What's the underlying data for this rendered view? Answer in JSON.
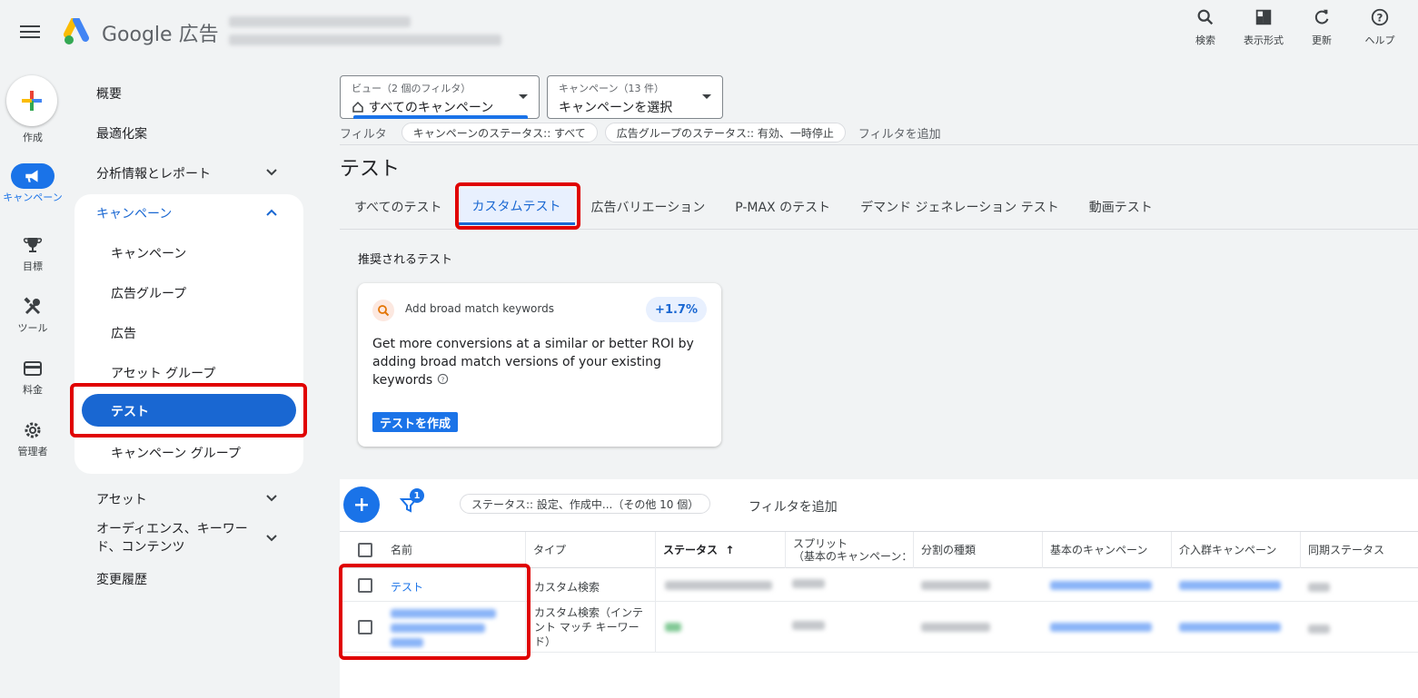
{
  "header": {
    "brand": "Google 広告",
    "actions": [
      {
        "label": "検索",
        "icon": "search-icon"
      },
      {
        "label": "表示形式",
        "icon": "appearance-icon"
      },
      {
        "label": "更新",
        "icon": "refresh-icon"
      },
      {
        "label": "ヘルプ",
        "icon": "help-icon"
      }
    ]
  },
  "rail": {
    "create": "作成",
    "campaign": "キャンペーン",
    "goals": "目標",
    "tools": "ツール",
    "billing": "料金",
    "admin": "管理者"
  },
  "sidebar": {
    "overview": "概要",
    "recommendations": "最適化案",
    "insights": "分析情報とレポート",
    "campaigns": "キャンペーン",
    "sub": [
      "キャンペーン",
      "広告グループ",
      "広告",
      "アセット グループ",
      "テスト",
      "キャンペーン グループ"
    ],
    "assets": "アセット",
    "audiences": "オーディエンス、キーワード、コンテンツ",
    "audiences_line1": "オーディエンス、キーワー",
    "audiences_line2": "ド、コンテンツ",
    "change_history": "変更履歴"
  },
  "view": {
    "view_label": "ビュー（2 個のフィルタ）",
    "view_value": "すべてのキャンペーン",
    "campaign_label": "キャンペーン（13 件）",
    "campaign_value": "キャンペーンを選択"
  },
  "filters": {
    "label": "フィルタ",
    "chips": [
      "キャンペーンのステータス:: すべて",
      "広告グループのステータス:: 有効、一時停止"
    ],
    "add": "フィルタを追加"
  },
  "page_title": "テスト",
  "tabs": [
    "すべてのテスト",
    "カスタムテスト",
    "広告バリエーション",
    "P-MAX のテスト",
    "デマンド ジェネレーション テスト",
    "動画テスト"
  ],
  "recommended": {
    "title": "推奨されるテスト",
    "card_head": "Add broad match keywords",
    "badge": "+1.7%",
    "body": "Get more conversions at a similar or better ROI by adding broad match versions of your existing keywords",
    "help_icon": "help-circle-icon",
    "button": "テストを作成"
  },
  "table": {
    "filter_count": "1",
    "status_chip": "ステータス:: 設定、作成中...（その他 10 個）",
    "add_filter": "フィルタを追加",
    "columns": [
      "名前",
      "タイプ",
      "ステータス",
      "スプリット（基本のキャンペーン：",
      "分割の種類",
      "基本のキャンペーン",
      "介入群キャンペーン",
      "同期ステータス"
    ],
    "split_line1": "スプリット",
    "split_line2": "（基本のキャンペーン：",
    "sort_arrow": "↑",
    "rows": [
      {
        "name": "テスト",
        "type": "カスタム検索"
      },
      {
        "name": "",
        "type": "カスタム検索（インテント マッチ キーワード）",
        "type_line1": "カスタム検索（インテ",
        "type_line2": "ント マッチ キーワー",
        "type_line3": "ド）"
      }
    ]
  },
  "colors": {
    "accent": "#1a73e8",
    "highlight": "#e00000"
  }
}
